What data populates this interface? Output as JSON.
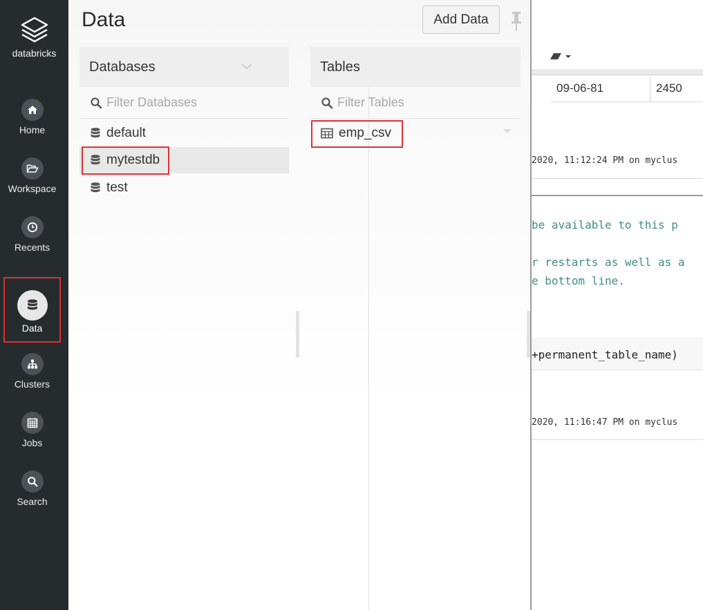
{
  "sidebar": {
    "brand": {
      "label": "databricks",
      "icon": "layers-icon"
    },
    "items": [
      {
        "key": "home",
        "label": "Home",
        "icon": "home-icon"
      },
      {
        "key": "workspace",
        "label": "Workspace",
        "icon": "folder-open-icon"
      },
      {
        "key": "recents",
        "label": "Recents",
        "icon": "clock-icon"
      },
      {
        "key": "data",
        "label": "Data",
        "icon": "database-icon",
        "active": true
      },
      {
        "key": "clusters",
        "label": "Clusters",
        "icon": "sitemap-icon"
      },
      {
        "key": "jobs",
        "label": "Jobs",
        "icon": "calendar-icon"
      },
      {
        "key": "search",
        "label": "Search",
        "icon": "search-icon"
      }
    ]
  },
  "drawer": {
    "title": "Data",
    "add_data_label": "Add Data",
    "databases": {
      "header": "Databases",
      "filter_placeholder": "Filter Databases",
      "items": [
        {
          "name": "default",
          "selected": false
        },
        {
          "name": "mytestdb",
          "selected": true
        },
        {
          "name": "test",
          "selected": false
        }
      ]
    },
    "tables": {
      "header": "Tables",
      "filter_placeholder": "Filter Tables",
      "items": [
        {
          "name": "emp_csv"
        }
      ]
    }
  },
  "notebook": {
    "row": {
      "date": "09-06-81",
      "value": "2450"
    },
    "meta1": "2020, 11:12:24 PM on myclus",
    "comment1": " be available to this p",
    "comment2": "r restarts as well as a",
    "comment3": "e bottom line.",
    "code1": "+permanent_table_name)",
    "meta2": "2020, 11:16:47 PM on myclus"
  },
  "colors": {
    "sidebar_bg": "#262b2e",
    "highlight": "#e03131",
    "comment_text": "#3f8e80"
  }
}
